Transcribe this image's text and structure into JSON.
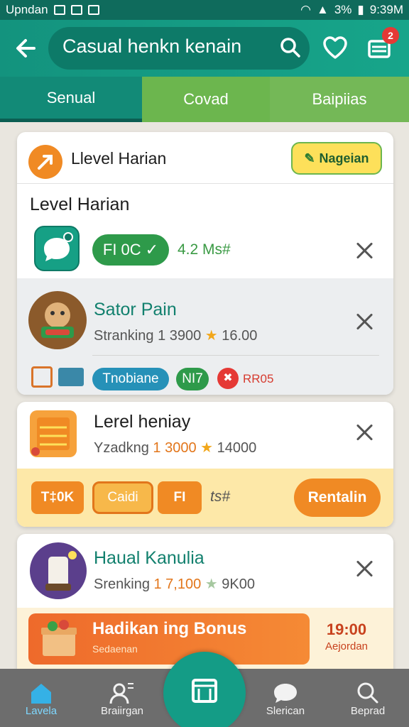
{
  "statusbar": {
    "app": "Upndan",
    "time": "9:39M",
    "battery": "3%"
  },
  "header": {
    "search_text": "Casual  henkn kenain",
    "cart_count": "2"
  },
  "tabs": [
    {
      "label": "Senual"
    },
    {
      "label": "Covad"
    },
    {
      "label": "Baipiias"
    }
  ],
  "card1": {
    "header_title": "Llevel Harian",
    "action_label": "Nageian",
    "section_title": "Level Harian",
    "row1": {
      "pill": "FI 0C",
      "meta": "4.2 Ms#"
    },
    "row2": {
      "title": "Sator Pain",
      "ranking_label": "Stranking",
      "ranking_value": "1 3900",
      "rating": "16.00"
    },
    "tags": [
      {
        "label": "Tnobiane"
      },
      {
        "label": "NI7"
      },
      {
        "label": "RR05"
      }
    ]
  },
  "card2": {
    "title": "Lerel heniay",
    "ranking_label": "Yzadkng",
    "ranking_value": "1 3000",
    "rating": "14000",
    "chips": [
      {
        "label": "T‡0K"
      },
      {
        "label": "Caidi"
      },
      {
        "label": "FI"
      }
    ],
    "meta": "ts#",
    "cta_label": "Rentalin"
  },
  "card3": {
    "title": "Haual Kanulia",
    "ranking_label": "Srenking",
    "ranking_value": "1 7,100",
    "rating": "9K00",
    "bonus_title": "Hadikan ing Bonus",
    "bonus_sub": "Sedaenan",
    "bonus_time": "19:00",
    "bonus_time_label": "Aejordan"
  },
  "bottom_nav": [
    {
      "label": "Lavela"
    },
    {
      "label": "Braiirgan"
    },
    {
      "label": "Slerican"
    },
    {
      "label": "Beprad"
    }
  ],
  "colors": {
    "primary": "#149c86",
    "accent_green": "#6cb64e",
    "orange": "#f08a24",
    "yellow": "#fde05a"
  }
}
